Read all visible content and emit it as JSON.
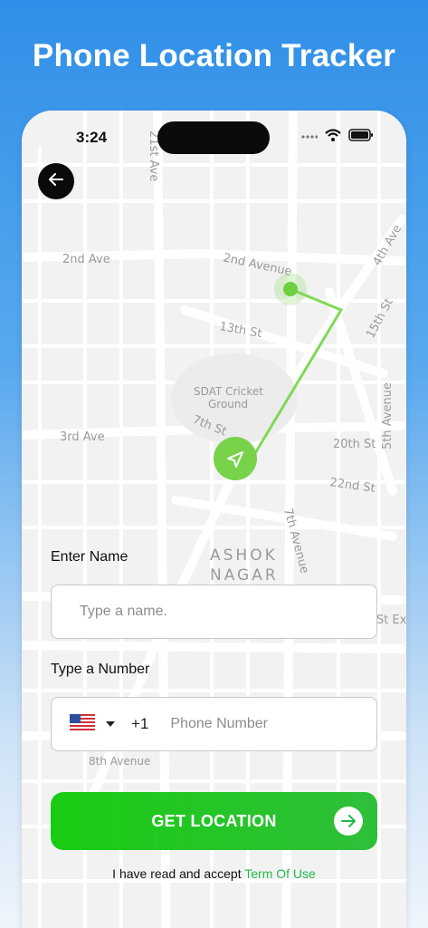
{
  "header": {
    "title": "Phone Location Tracker"
  },
  "status_bar": {
    "time": "3:24"
  },
  "map": {
    "street_labels": [
      "21st Ave",
      "2nd Ave",
      "2nd Avenue",
      "4th Ave",
      "15th St",
      "13th St",
      "SDAT Cricket",
      "Ground",
      "7th St",
      "3rd Ave",
      "20th St",
      "5th Avenue",
      "22nd St",
      "7th Avenue",
      "ASHOK",
      "NAGAR",
      "St Ex",
      "8th Avenue"
    ],
    "route_color": "#7ed957"
  },
  "form": {
    "name_label": "Enter Name",
    "name_placeholder": "Type a name.",
    "number_label": "Type a Number",
    "country_flag": "us-flag",
    "dial_code": "+1",
    "phone_placeholder": "Phone Number"
  },
  "cta": {
    "label": "GET LOCATION",
    "color": "#19cc12"
  },
  "terms": {
    "text": "I have read and accept",
    "link": "Term Of Use",
    "link_color": "#22b84a"
  }
}
